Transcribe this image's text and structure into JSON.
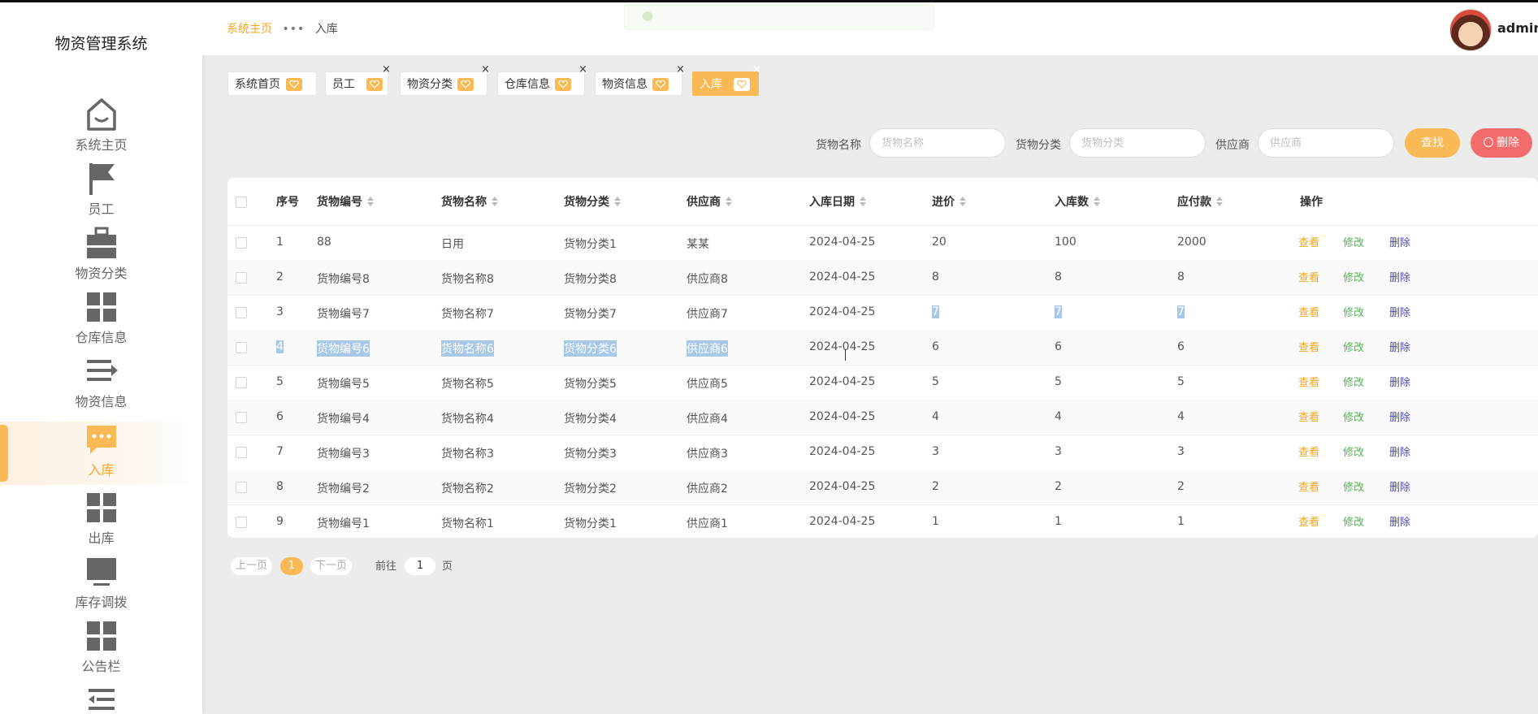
{
  "app": {
    "title": "物资管理系统"
  },
  "sidebar": {
    "items": [
      {
        "label": "系统主页",
        "icon": "home-icon"
      },
      {
        "label": "员工",
        "icon": "flag-icon"
      },
      {
        "label": "物资分类",
        "icon": "briefcase-icon"
      },
      {
        "label": "仓库信息",
        "icon": "grid-icon"
      },
      {
        "label": "物资信息",
        "icon": "list-icon"
      },
      {
        "label": "入库",
        "icon": "chat-icon",
        "active": true
      },
      {
        "label": "出库",
        "icon": "grid-icon"
      },
      {
        "label": "库存调拨",
        "icon": "monitor-icon"
      },
      {
        "label": "公告栏",
        "icon": "grid-icon"
      }
    ]
  },
  "header": {
    "breadcrumb": {
      "home": "系统主页",
      "separator": "•••",
      "current": "入库"
    },
    "username": "admin"
  },
  "tabs": [
    {
      "label": "系统首页"
    },
    {
      "label": "员工"
    },
    {
      "label": "物资分类"
    },
    {
      "label": "仓库信息"
    },
    {
      "label": "物资信息"
    },
    {
      "label": "入库",
      "active": true
    }
  ],
  "search": {
    "name_label": "货物名称",
    "name_placeholder": "货物名称",
    "category_label": "货物分类",
    "category_placeholder": "货物分类",
    "supplier_label": "供应商",
    "supplier_placeholder": "供应商",
    "find_button": "查找",
    "delete_button": "删除"
  },
  "table": {
    "headers": [
      "序号",
      "货物编号",
      "货物名称",
      "货物分类",
      "供应商",
      "入库日期",
      "进价",
      "入库数",
      "应付款",
      "操作"
    ],
    "actions": {
      "view": "查看",
      "edit": "修改",
      "delete": "删除"
    },
    "rows": [
      [
        "1",
        "88",
        "日用",
        "货物分类1",
        "某某",
        "2024-04-25",
        "20",
        "100",
        "2000"
      ],
      [
        "2",
        "货物编号8",
        "货物名称8",
        "货物分类8",
        "供应商8",
        "2024-04-25",
        "8",
        "8",
        "8"
      ],
      [
        "3",
        "货物编号7",
        "货物名称7",
        "货物分类7",
        "供应商7",
        "2024-04-25",
        "7",
        "7",
        "7"
      ],
      [
        "4",
        "货物编号6",
        "货物名称6",
        "货物分类6",
        "供应商6",
        "2024-04-25",
        "6",
        "6",
        "6"
      ],
      [
        "5",
        "货物编号5",
        "货物名称5",
        "货物分类5",
        "供应商5",
        "2024-04-25",
        "5",
        "5",
        "5"
      ],
      [
        "6",
        "货物编号4",
        "货物名称4",
        "货物分类4",
        "供应商4",
        "2024-04-25",
        "4",
        "4",
        "4"
      ],
      [
        "7",
        "货物编号3",
        "货物名称3",
        "货物分类3",
        "供应商3",
        "2024-04-25",
        "3",
        "3",
        "3"
      ],
      [
        "8",
        "货物编号2",
        "货物名称2",
        "货物分类2",
        "供应商2",
        "2024-04-25",
        "2",
        "2",
        "2"
      ],
      [
        "9",
        "货物编号1",
        "货物名称1",
        "货物分类1",
        "供应商1",
        "2024-04-25",
        "1",
        "1",
        "1"
      ]
    ]
  },
  "pagination": {
    "prev": "上一页",
    "current": "1",
    "next": "下一页",
    "goto_label": "前往",
    "goto_value": "1",
    "page_suffix": "页"
  },
  "colors": {
    "accent": "#f9b955",
    "danger": "#f46b6b",
    "edit": "#4fb84f",
    "delete_link": "#4d4dcc"
  }
}
